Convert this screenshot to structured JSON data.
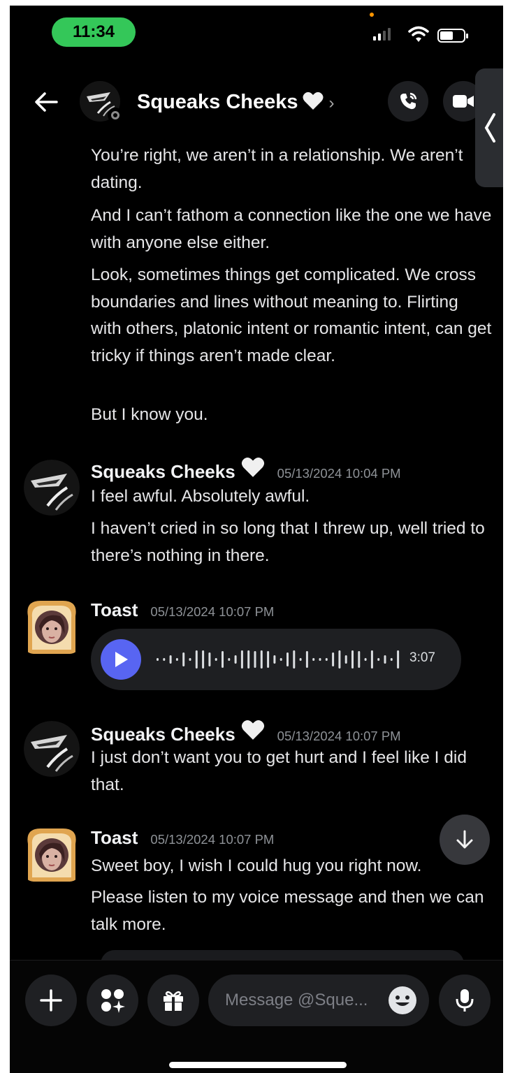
{
  "status_bar": {
    "time": "11:34"
  },
  "header": {
    "title": "Squeaks Cheeks",
    "heart": "white-heart-icon",
    "chevron": "›"
  },
  "messages": {
    "continued": [
      "You’re right, we aren’t in a relationship. We aren’t dating.",
      "And I can’t fathom a connection like the one we have with anyone else either.",
      "Look, sometimes things get complicated. We cross boundaries and lines without meaning to. Flirting with others, platonic intent or romantic intent, can get tricky if things aren’t made clear.",
      "But I know you."
    ],
    "group1": {
      "author": "Squeaks Cheeks",
      "timestamp": "05/13/2024 10:04 PM",
      "lines": [
        "I feel awful. Absolutely awful.",
        "I haven’t cried in so long that I threw up, well tried to there’s nothing in there."
      ]
    },
    "group2": {
      "author": "Toast",
      "timestamp": "05/13/2024 10:07 PM",
      "voice_duration": "3:07"
    },
    "group3": {
      "author": "Squeaks Cheeks",
      "timestamp": "05/13/2024 10:07 PM",
      "lines": [
        "I just don’t want you to get hurt and I feel like I did that."
      ]
    },
    "group4": {
      "author": "Toast",
      "timestamp": "05/13/2024 10:07 PM",
      "lines": [
        "Sweet boy, I wish I could hug you right now.",
        "Please listen to my voice message and then we can talk more."
      ]
    }
  },
  "composer": {
    "placeholder": "Message @Sque..."
  },
  "colors": {
    "background": "#000000",
    "accent": "#5865f2",
    "status_green": "#34c759"
  }
}
